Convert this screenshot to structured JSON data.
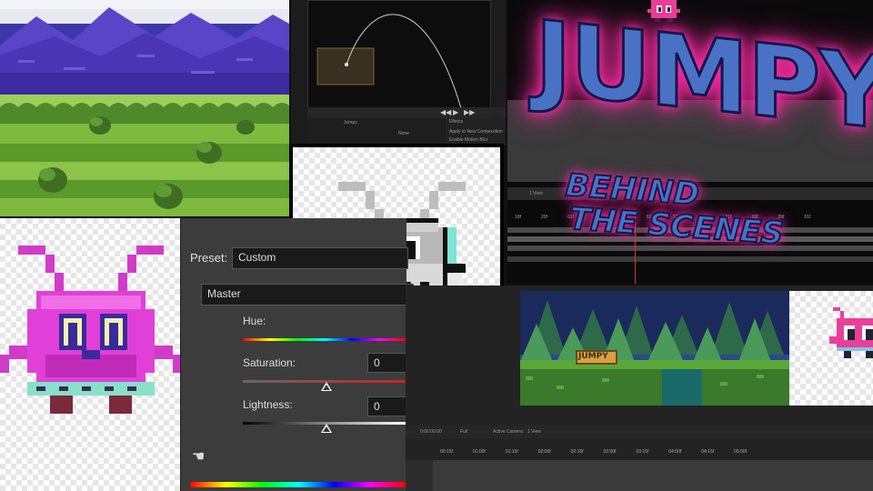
{
  "title": {
    "main": "JUMPY",
    "sub_line1": "BEHIND",
    "sub_line2": "THE SCENES"
  },
  "hsl_panel": {
    "preset_label": "Preset:",
    "preset_value": "Custom",
    "channel_value": "Master",
    "hue_label": "Hue:",
    "saturation_label": "Saturation:",
    "saturation_value": "0",
    "lightness_label": "Lightness:",
    "lightness_value": "0"
  },
  "ae_timeline": {
    "view_label": "1 View",
    "camera_label": "Active Camera",
    "zoom_label": "Full",
    "view_label_2": "1 View",
    "timecode": "0:00:00:00"
  },
  "motion_panel": {
    "effects_label": "Effects",
    "layer_label": "Jumpy",
    "parent_label": "None",
    "option_label": "Apply to New Composition",
    "option_label_2": "Enable Motion Blur"
  },
  "game_sign": {
    "text": "JUMPY"
  },
  "colors": {
    "glow_pink": "#ff2da6",
    "title_blue": "#4a72c4",
    "character_magenta": "#e040d8",
    "mountain_purple": "#5a44c8",
    "grass_green": "#6aa83a"
  }
}
